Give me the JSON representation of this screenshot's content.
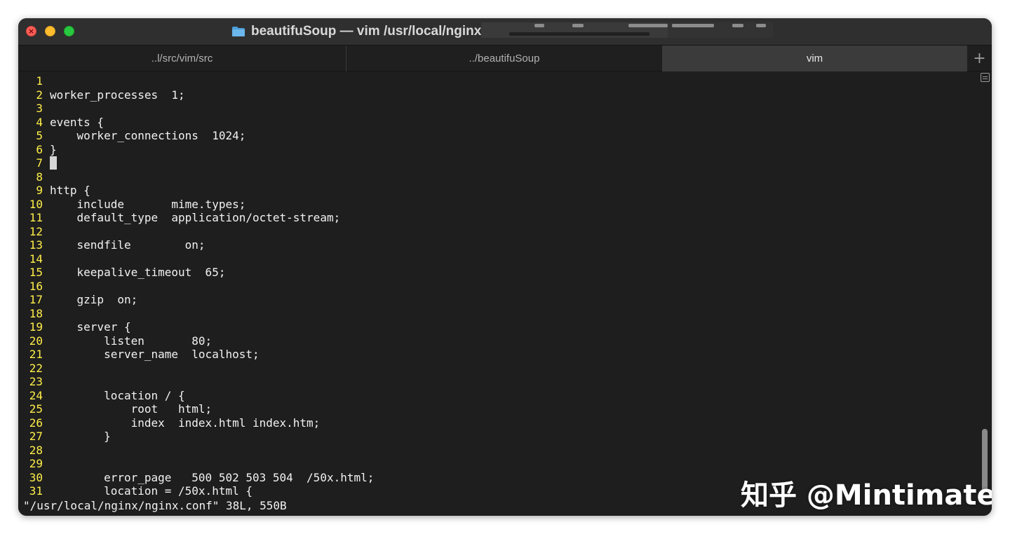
{
  "window": {
    "title": "beautifuSoup — vim /usr/local/nginx/"
  },
  "tabs": [
    {
      "label": "..l/src/vim/src",
      "active": false
    },
    {
      "label": "../beautifuSoup",
      "active": false
    },
    {
      "label": "vim",
      "active": true
    }
  ],
  "tab_add_label": "+",
  "editor": {
    "lines": [
      {
        "num": "1",
        "text": ""
      },
      {
        "num": "2",
        "text": "worker_processes  1;"
      },
      {
        "num": "3",
        "text": ""
      },
      {
        "num": "4",
        "text": "events {"
      },
      {
        "num": "5",
        "text": "    worker_connections  1024;"
      },
      {
        "num": "6",
        "text": "}"
      },
      {
        "num": "7",
        "text": ""
      },
      {
        "num": "8",
        "text": ""
      },
      {
        "num": "9",
        "text": "http {"
      },
      {
        "num": "10",
        "text": "    include       mime.types;"
      },
      {
        "num": "11",
        "text": "    default_type  application/octet-stream;"
      },
      {
        "num": "12",
        "text": ""
      },
      {
        "num": "13",
        "text": "    sendfile        on;"
      },
      {
        "num": "14",
        "text": ""
      },
      {
        "num": "15",
        "text": "    keepalive_timeout  65;"
      },
      {
        "num": "16",
        "text": ""
      },
      {
        "num": "17",
        "text": "    gzip  on;"
      },
      {
        "num": "18",
        "text": ""
      },
      {
        "num": "19",
        "text": "    server {"
      },
      {
        "num": "20",
        "text": "        listen       80;"
      },
      {
        "num": "21",
        "text": "        server_name  localhost;"
      },
      {
        "num": "22",
        "text": ""
      },
      {
        "num": "23",
        "text": ""
      },
      {
        "num": "24",
        "text": "        location / {"
      },
      {
        "num": "25",
        "text": "            root   html;"
      },
      {
        "num": "26",
        "text": "            index  index.html index.htm;"
      },
      {
        "num": "27",
        "text": "        }"
      },
      {
        "num": "28",
        "text": ""
      },
      {
        "num": "29",
        "text": ""
      },
      {
        "num": "30",
        "text": "        error_page   500 502 503 504  /50x.html;"
      },
      {
        "num": "31",
        "text": "        location = /50x.html {"
      }
    ],
    "cursor_line": "7",
    "status_line": "\"/usr/local/nginx/nginx.conf\" 38L, 550B"
  },
  "watermark": "知乎 @Mintimate",
  "colors": {
    "line_number": "#ffef4a",
    "text": "#f2f2f2",
    "background": "#1e1e1e",
    "active_tab": "#3b3b3c"
  }
}
